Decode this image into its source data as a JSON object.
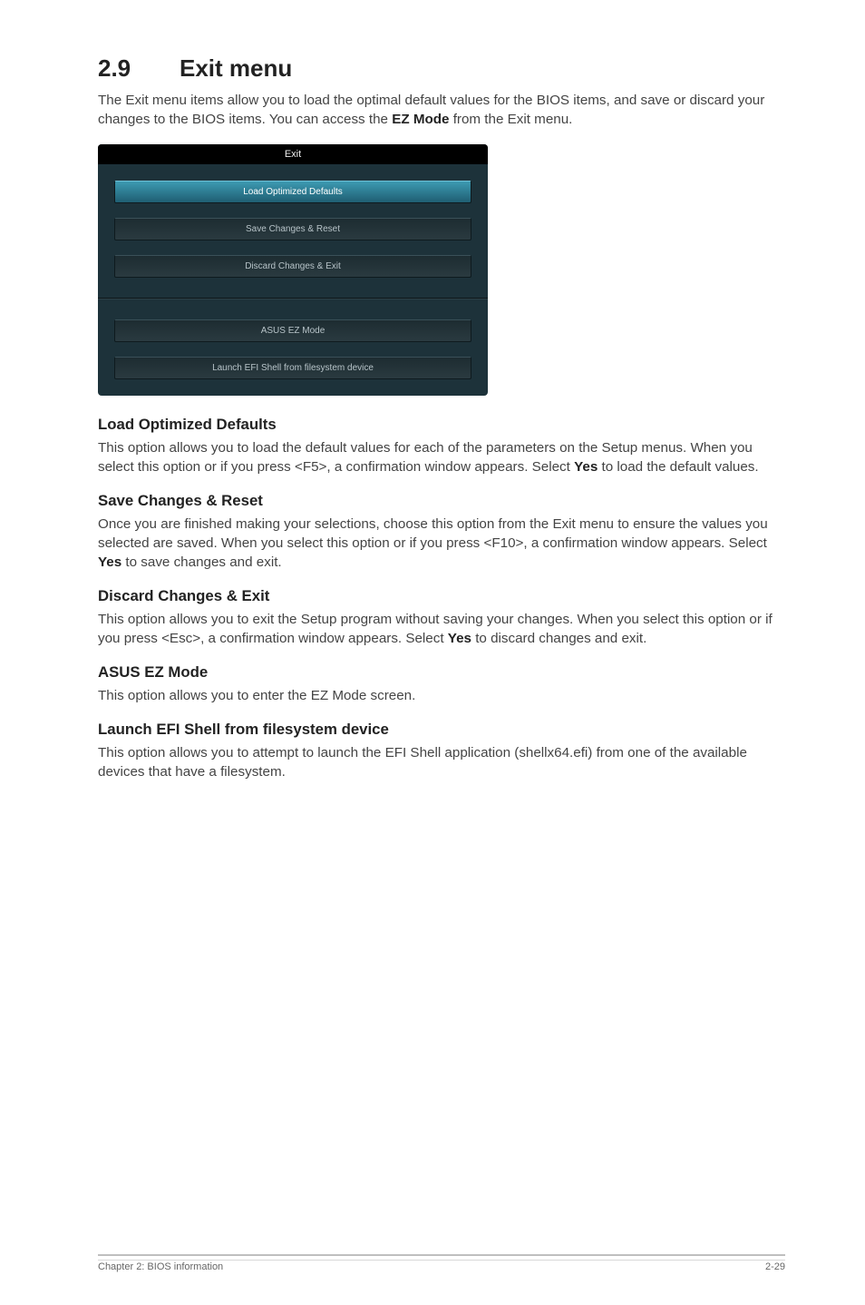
{
  "section": {
    "number": "2.9",
    "title": "Exit menu",
    "intro_part1": "The Exit menu items allow you to load the optimal default values for the BIOS items, and save or discard your changes to the BIOS items. You can access the ",
    "intro_bold": "EZ Mode",
    "intro_part2": " from the Exit menu."
  },
  "bios": {
    "title": "Exit",
    "buttons": {
      "load_defaults": "Load Optimized Defaults",
      "save_reset": "Save Changes & Reset",
      "discard_exit": "Discard Changes & Exit",
      "ez_mode": "ASUS EZ Mode",
      "efi_shell": "Launch EFI Shell from filesystem device"
    }
  },
  "descriptions": {
    "load_defaults": {
      "heading": "Load Optimized Defaults",
      "p1": "This option allows you to load the default values for each of the parameters on the Setup menus. When you select this option or if you press <F5>, a confirmation window appears. Select ",
      "bold": "Yes",
      "p2": " to load the default values."
    },
    "save_reset": {
      "heading": "Save Changes & Reset",
      "p1": "Once you are finished making your selections, choose this option from the Exit menu to ensure the values you selected are saved. When you select this option or if you press <F10>, a confirmation window appears. Select ",
      "bold": "Yes",
      "p2": " to save changes and exit."
    },
    "discard_exit": {
      "heading": "Discard Changes & Exit",
      "p1": "This option allows you to exit the Setup program without saving your changes. When you select this option or if you press <Esc>, a confirmation window appears. Select ",
      "bold": "Yes",
      "p2": " to discard changes and exit."
    },
    "ez_mode": {
      "heading": "ASUS EZ Mode",
      "text": "This option allows you to enter the EZ Mode screen."
    },
    "efi_shell": {
      "heading": "Launch EFI Shell from filesystem device",
      "text": "This option allows you to attempt to launch the EFI Shell application (shellx64.efi) from one of the available devices that have a filesystem."
    }
  },
  "footer": {
    "left": "Chapter 2: BIOS information",
    "right": "2-29"
  }
}
